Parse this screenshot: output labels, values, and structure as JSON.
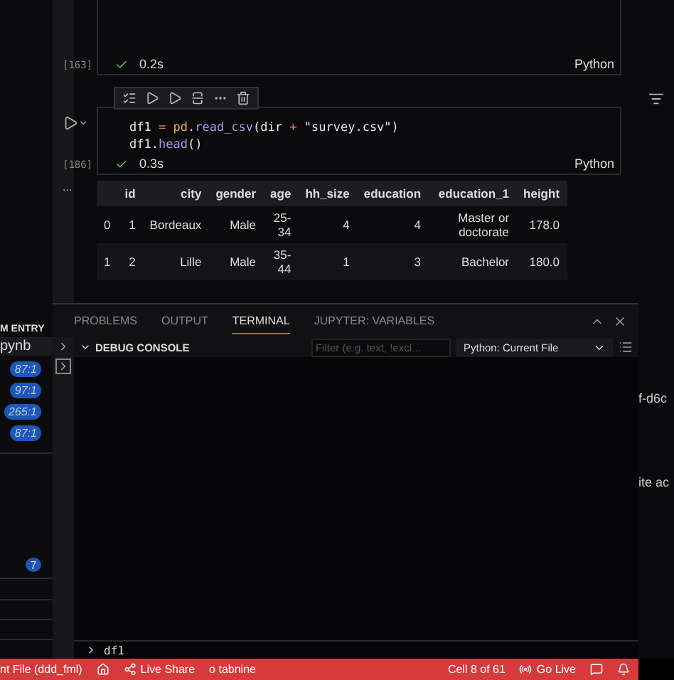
{
  "sidebar": {
    "header": "M ENTRY",
    "file": "pynb",
    "badges": [
      "87:1",
      "97:1",
      "265:1",
      "87:1"
    ],
    "count": "7"
  },
  "cells": [
    {
      "exec": "[163]",
      "succeeded": true,
      "time": "0.2s",
      "language": "Python"
    },
    {
      "exec": "[186]",
      "succeeded": true,
      "time": "0.3s",
      "language": "Python",
      "code": [
        [
          {
            "kind": "name",
            "text": "df1 "
          },
          {
            "kind": "op",
            "text": "="
          },
          {
            "kind": "module",
            "text": " pd"
          },
          {
            "kind": "punct",
            "text": "."
          },
          {
            "kind": "func",
            "text": "read_csv"
          },
          {
            "kind": "punct",
            "text": "(dir "
          },
          {
            "kind": "op",
            "text": "+"
          },
          {
            "kind": "string",
            "text": " \"survey.csv\""
          },
          {
            "kind": "punct",
            "text": ")"
          }
        ],
        [
          {
            "kind": "name",
            "text": "df1"
          },
          {
            "kind": "punct",
            "text": "."
          },
          {
            "kind": "func",
            "text": "head"
          },
          {
            "kind": "punct",
            "text": "()"
          }
        ]
      ]
    }
  ],
  "output": {
    "marker": "...",
    "columns": [
      "",
      "id",
      "city",
      "gender",
      "age",
      "hh_size",
      "education",
      "education_1",
      "height"
    ],
    "rows": [
      [
        "0",
        "1",
        "Bordeaux",
        "Male",
        "25-34",
        "4",
        "4",
        "Master or doctorate",
        "178.0"
      ],
      [
        "1",
        "2",
        "Lille",
        "Male",
        "35-44",
        "1",
        "3",
        "Bachelor",
        "180.0"
      ]
    ]
  },
  "panel": {
    "tabs": [
      {
        "label": "PROBLEMS",
        "selected": false
      },
      {
        "label": "OUTPUT",
        "selected": false
      },
      {
        "label": "TERMINAL",
        "selected": true
      },
      {
        "label": "JUPYTER: VARIABLES",
        "selected": false
      }
    ],
    "console": {
      "title": "DEBUG CONSOLE",
      "expanded": true,
      "filter_placeholder": "Filter (e.g. text, !excl...",
      "config": "Python: Current File",
      "input": "df1"
    }
  },
  "right_strip": [
    "f-d6c",
    "ite ac"
  ],
  "status_bar": {
    "left": [
      {
        "kind": "text",
        "text": "nt File (ddd_fml)"
      },
      {
        "kind": "home"
      },
      {
        "kind": "share",
        "text": "Live Share"
      },
      {
        "kind": "text",
        "text": "o tabnine"
      }
    ],
    "right": [
      {
        "kind": "text",
        "text": "Cell 8 of 61"
      },
      {
        "kind": "live",
        "text": "Go Live"
      },
      {
        "kind": "feedback"
      },
      {
        "kind": "bell"
      }
    ]
  }
}
